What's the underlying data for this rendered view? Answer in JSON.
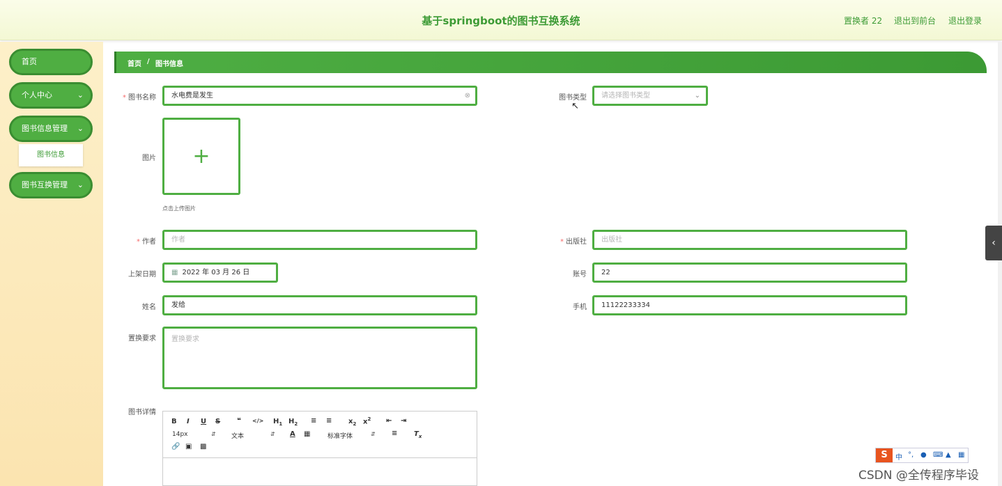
{
  "header": {
    "title": "基于springboot的图书互换系统",
    "user": "置换者 22",
    "front_link": "退出到前台",
    "logout_link": "退出登录"
  },
  "sidebar": {
    "items": [
      {
        "label": "首页"
      },
      {
        "label": "个人中心",
        "chevron": "chevron-down-icon"
      },
      {
        "label": "图书信息管理",
        "chevron": "chevron-down-icon"
      },
      {
        "label": "图书互换管理",
        "chevron": "chevron-down-icon"
      }
    ],
    "submenu_item": "图书信息"
  },
  "breadcrumb": {
    "home": "首页",
    "separator": "/",
    "current": "图书信息"
  },
  "form": {
    "book_name": {
      "label": "图书名称",
      "value": "水电费是发生",
      "required": true
    },
    "book_type": {
      "label": "图书类型",
      "placeholder": "请选择图书类型"
    },
    "image": {
      "label": "图片",
      "tip": "点击上传图片"
    },
    "author": {
      "label": "作者",
      "placeholder": "作者",
      "required": true
    },
    "publisher": {
      "label": "出版社",
      "placeholder": "出版社",
      "required": true
    },
    "shelf_date": {
      "label": "上架日期",
      "value": "2022 年 03 月 26 日"
    },
    "account": {
      "label": "账号",
      "value": "22"
    },
    "name": {
      "label": "姓名",
      "value": "发给"
    },
    "phone": {
      "label": "手机",
      "value": "11122233334"
    },
    "requirement": {
      "label": "置换要求",
      "placeholder": "置换要求"
    },
    "details": {
      "label": "图书详情"
    }
  },
  "editor": {
    "font_size": "14px",
    "block_format": "文本",
    "font_family": "标准字体"
  },
  "ime": {
    "mode": "中"
  },
  "watermark": "CSDN @全传程序毕设",
  "colors": {
    "accent": "#4fae42",
    "accent_dark": "#3a8d31",
    "sidebar_bg": "#fbe4b0"
  }
}
